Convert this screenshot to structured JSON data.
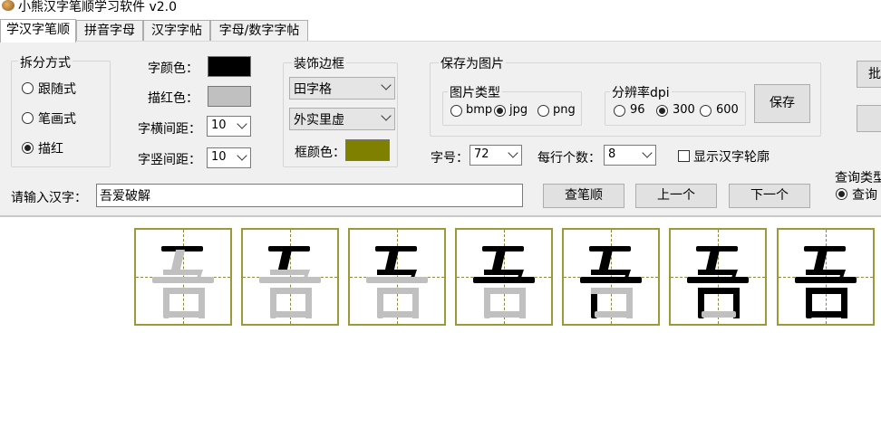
{
  "window": {
    "title": "小熊汉字笔顺学习软件 v2.0"
  },
  "tabs": [
    "学汉字笔顺",
    "拼音字母",
    "汉字字帖",
    "字母/数字字帖"
  ],
  "split_mode": {
    "title": "拆分方式",
    "options": [
      "跟随式",
      "笔画式",
      "描红"
    ],
    "selected": "描红"
  },
  "colors": {
    "char_color_label": "字颜色：",
    "char_color": "#000000",
    "trace_color_label": "描红色：",
    "trace_color": "#c0c0c0",
    "frame_color": "#808000",
    "accent_outline": "#9a9a3a"
  },
  "spacing": {
    "h_label": "字横间距：",
    "h_value": "10",
    "v_label": "字竖间距：",
    "v_value": "10"
  },
  "border": {
    "title": "装饰边框",
    "grid_type": "田字格",
    "line_style": "外实里虚",
    "frame_color_label": "框颜色："
  },
  "save": {
    "title": "保存为图片",
    "type_title": "图片类型",
    "types": [
      "bmp",
      "jpg",
      "png"
    ],
    "type_selected": "jpg",
    "dpi_title": "分辨率dpi",
    "dpis": [
      "96",
      "300",
      "600"
    ],
    "dpi_selected": "300",
    "save_button": "保存"
  },
  "font_size": {
    "label": "字号：",
    "value": "72"
  },
  "per_row": {
    "label": "每行个数：",
    "value": "8"
  },
  "outline": {
    "label": "显示汉字轮廓",
    "checked": false
  },
  "input": {
    "label": "请输入汉字：",
    "value": "吾爱破解"
  },
  "actions": {
    "lookup": "查笔顺",
    "prev": "上一个",
    "next": "下一个"
  },
  "right_cut": {
    "batch_partial": "批",
    "query_type_partial": "查询类型",
    "query_option_partial": "查询"
  },
  "stroke_frames": {
    "character": "吾",
    "total_strokes": 7
  }
}
